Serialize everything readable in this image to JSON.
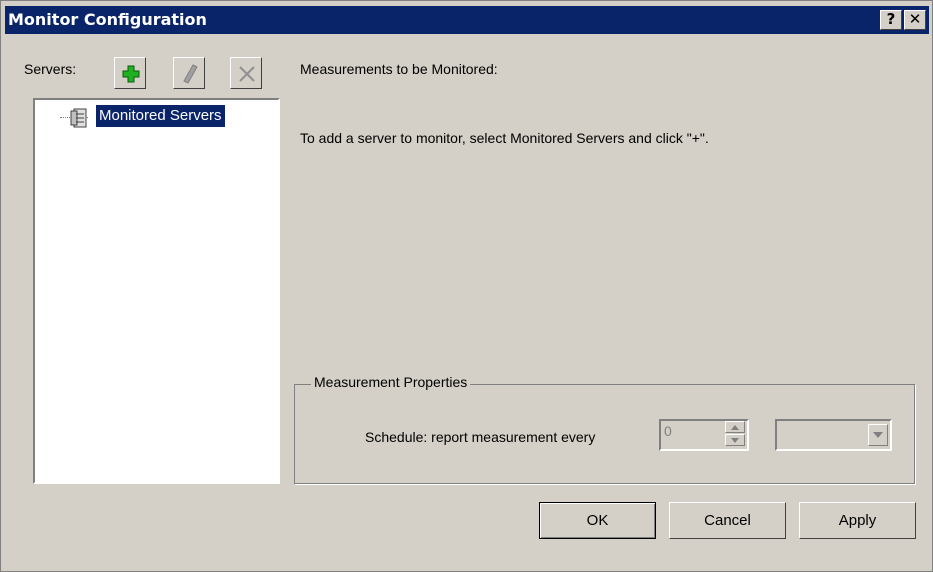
{
  "window": {
    "title": "Monitor Configuration",
    "help_button": "?",
    "close_button": "✕"
  },
  "servers": {
    "label": "Servers:",
    "toolbar": {
      "add_icon": "plus-icon",
      "edit_icon": "pencil-icon",
      "delete_icon": "x-icon"
    },
    "tree": {
      "root_label": "Monitored Servers",
      "root_icon": "server-database-icon",
      "root_selected": true
    }
  },
  "measurements": {
    "title": "Measurements to be Monitored:",
    "hint": "To add a server to monitor, select Monitored Servers and click \"+\"."
  },
  "properties": {
    "legend": "Measurement Properties",
    "schedule_label": "Schedule: report measurement every",
    "interval_value": "0",
    "unit_value": ""
  },
  "buttons": {
    "ok": "OK",
    "cancel": "Cancel",
    "apply": "Apply"
  },
  "colors": {
    "titlebar": "#0a246a",
    "face": "#d4d0c8",
    "selection": "#0a246a",
    "add_icon": "#1fb11f"
  }
}
